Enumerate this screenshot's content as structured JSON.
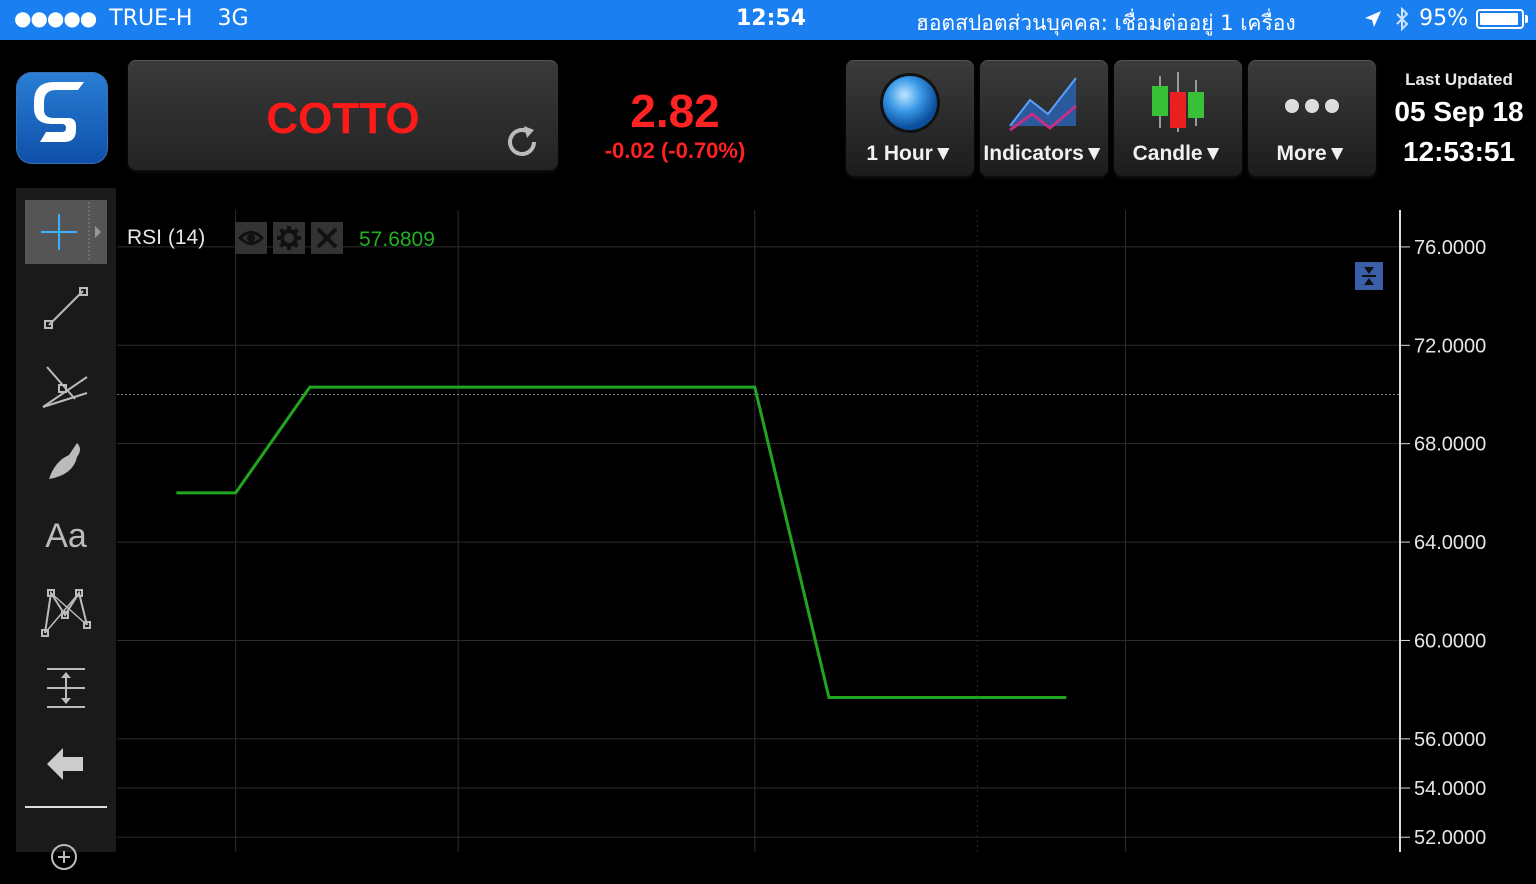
{
  "status_bar": {
    "carrier": "TRUE-H",
    "network": "3G",
    "time": "12:54",
    "hotspot": "ฮอตสปอตส่วนบุคคล: เชื่อมต่ออยู่ 1 เครื่อง",
    "battery": "95%",
    "battery_level": 0.95
  },
  "header": {
    "symbol": "COTTO",
    "price": "2.82",
    "change": "-0.02 (-0.70%)",
    "price_color": "#ff2222",
    "toolbar": {
      "interval_label": "1 Hour▼",
      "indicators_label": "Indicators▼",
      "chart_type_label": "Candle▼",
      "more_label": "More▼"
    },
    "last_updated": {
      "label": "Last Updated",
      "date": "05 Sep 18",
      "time": "12:53:51"
    }
  },
  "sidebar": {
    "tools": [
      "crosshair-icon",
      "line-icon",
      "fibonacci-icon",
      "brush-icon",
      "text-icon",
      "pattern-icon",
      "measure-icon",
      "back-arrow-icon",
      "zoom-in-icon"
    ],
    "text_tool_label": "Aa"
  },
  "indicator": {
    "name": "RSI (14)",
    "value": "57.6809",
    "value_color": "#22b122"
  },
  "chart_data": {
    "type": "line",
    "title": "RSI (14)",
    "xlabel": "",
    "ylabel": "",
    "y_tick_labels": [
      "76.0000",
      "72.0000",
      "68.0000",
      "64.0000",
      "60.0000",
      "56.0000",
      "54.0000",
      "52.0000"
    ],
    "y_tick_values": [
      76,
      72,
      68,
      64,
      60,
      56,
      54,
      52
    ],
    "ylim": [
      51.4,
      77.5
    ],
    "reference_line": 70,
    "grid": true,
    "series": [
      {
        "color": "#1fa51f",
        "points": [
          [
            0,
            66.0
          ],
          [
            0.8,
            66.0
          ],
          [
            1.8,
            70.3
          ],
          [
            7.8,
            70.3
          ],
          [
            8.8,
            57.68
          ],
          [
            12.0,
            57.68
          ]
        ]
      }
    ],
    "x_range": [
      -0.8,
      16.5
    ],
    "x_gridlines": [
      0.8,
      3.8,
      7.8,
      10.8,
      12.8
    ]
  }
}
